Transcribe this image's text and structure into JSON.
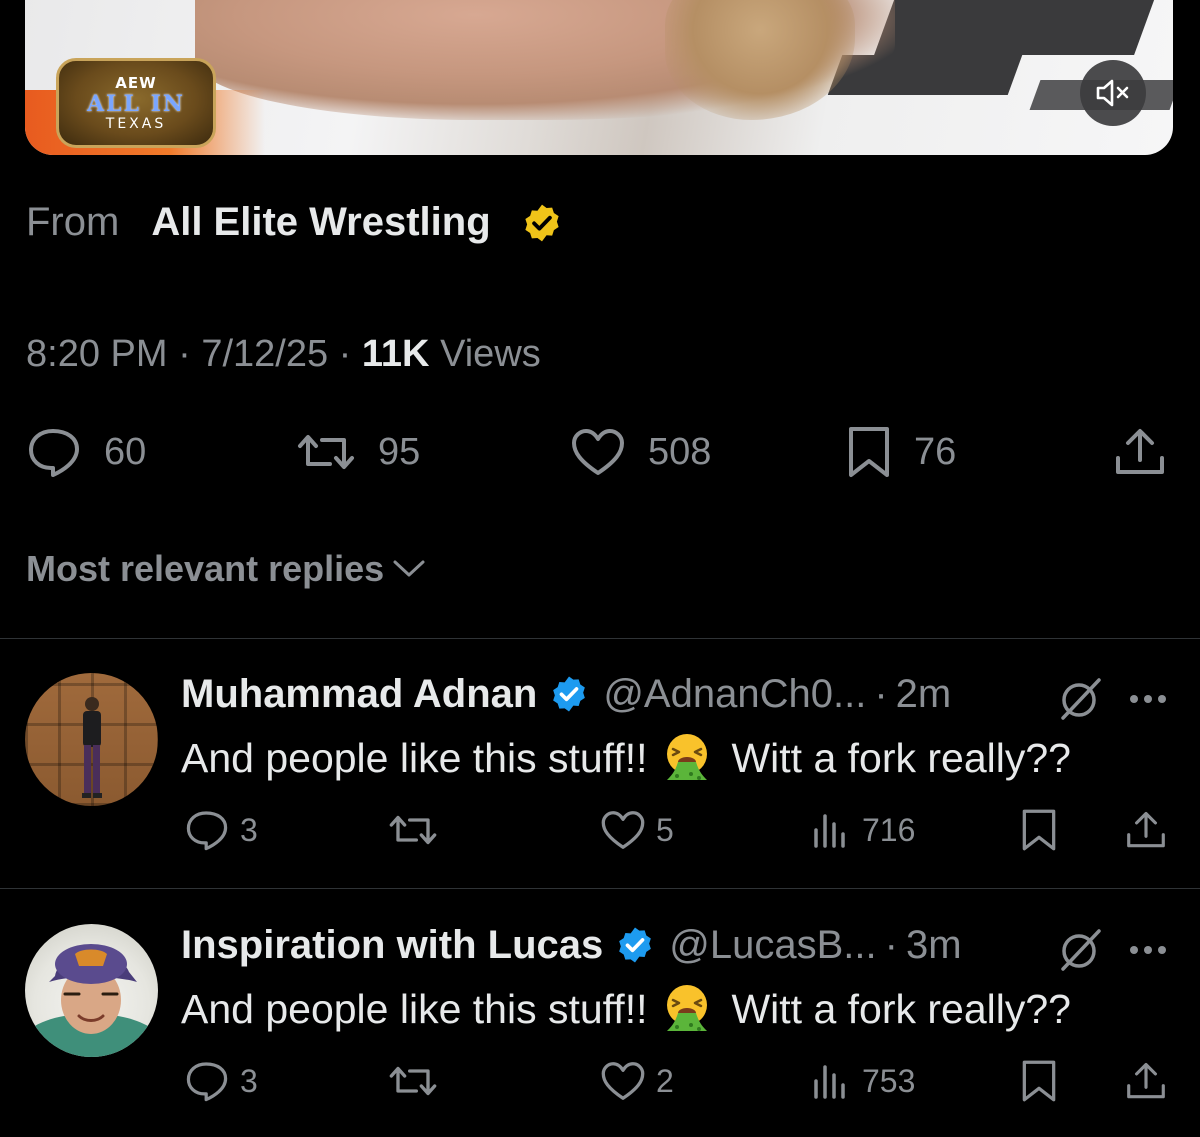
{
  "media": {
    "logo": {
      "line1": "AEW",
      "line2": "ALL IN",
      "line3": "TEXAS"
    },
    "mute_icon": "speaker-muted-icon"
  },
  "post": {
    "from_label": "From",
    "from_name": "All Elite Wrestling",
    "badge_color": "#f0c419",
    "time": "8:20 PM",
    "date": "7/12/25",
    "views_count": "11K",
    "views_label": "Views",
    "sep": "·",
    "stats": {
      "replies": "60",
      "reposts": "95",
      "likes": "508",
      "bookmarks": "76"
    }
  },
  "replies_sort": {
    "label": "Most relevant replies"
  },
  "replies": [
    {
      "name": "Muhammad Adnan",
      "handle": "@AdnanCh0...",
      "time": "2m",
      "text_before": "And people like this stuff!!",
      "emoji": "face-vomiting",
      "text_after": "Witt a fork really??",
      "reply_count": "3",
      "like_count": "5",
      "view_count": "716"
    },
    {
      "name": "Inspiration with Lucas",
      "handle": "@LucasB...",
      "time": "3m",
      "text_before": "And people like this stuff!!",
      "emoji": "face-vomiting",
      "text_after": "Witt a fork really??",
      "reply_count": "3",
      "like_count": "2",
      "view_count": "753"
    }
  ],
  "colors": {
    "background": "#000000",
    "text": "#e7e9ea",
    "muted": "#8b8f94",
    "verified_blue": "#1d9bf0",
    "verified_gold": "#f0c419"
  }
}
